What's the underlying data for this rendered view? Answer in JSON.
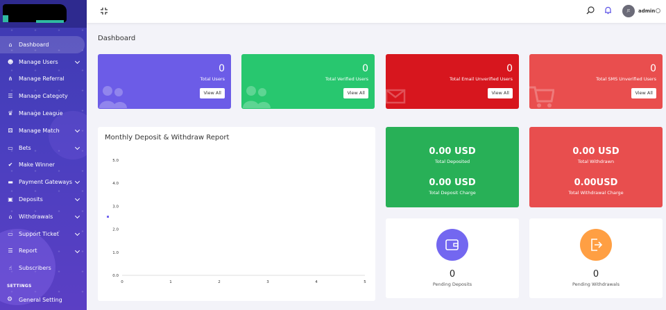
{
  "sidebar": {
    "items": [
      {
        "label": "Dashboard",
        "icon": "home-icon",
        "active": true
      },
      {
        "label": "Manage Users",
        "icon": "users-icon",
        "dropdown": true
      },
      {
        "label": "Manage Referral",
        "icon": "sitemap-icon"
      },
      {
        "label": "Manage Categoty",
        "icon": "list-icon"
      },
      {
        "label": "Manage League",
        "icon": "trophy-icon"
      },
      {
        "label": "Manage Match",
        "icon": "gamepad-icon",
        "dropdown": true
      },
      {
        "label": "Bets",
        "icon": "ticket-icon",
        "dropdown": true
      },
      {
        "label": "Make Winner",
        "icon": "user-check-icon"
      },
      {
        "label": "Payment Gateways",
        "icon": "credit-card-icon",
        "dropdown": true
      },
      {
        "label": "Deposits",
        "icon": "wallet-icon",
        "dropdown": true
      },
      {
        "label": "Withdrawals",
        "icon": "bank-icon",
        "dropdown": true
      },
      {
        "label": "Support Ticket",
        "icon": "ticket-icon",
        "dropdown": true
      },
      {
        "label": "Report",
        "icon": "list-icon",
        "dropdown": true
      },
      {
        "label": "Subscribers",
        "icon": "thumbs-up-icon"
      }
    ],
    "settings_heading": "SETTINGS",
    "general_setting": "General Setting"
  },
  "topbar": {
    "user_name": "admin",
    "avatar_initials": "JE"
  },
  "page_title": "Dashboard",
  "stats": [
    {
      "value": "0",
      "label": "Total Users",
      "button": "View All",
      "color": "#6c5ce7",
      "icon": "users-icon"
    },
    {
      "value": "0",
      "label": "Total Verified Users",
      "button": "View All",
      "color": "#28c76f",
      "icon": "users-icon"
    },
    {
      "value": "0",
      "label": "Total Email Unverified Users",
      "button": "View All",
      "color": "#d7161e",
      "icon": "envelope-icon"
    },
    {
      "value": "0",
      "label": "Total SMS Unverified Users",
      "button": "View All",
      "color": "#e94e4e",
      "icon": "cart-icon"
    }
  ],
  "amounts": [
    {
      "value": "0.00 USD",
      "label": "Total Deposited",
      "value2": "0.00 USD",
      "label2": "Total Deposit Charge",
      "color": "#28b057"
    },
    {
      "value": "0.00 USD",
      "label": "Total Withdrawn",
      "value2": "0.00USD",
      "label2": "Total Withdrawal Charge",
      "color": "#e84e4e"
    }
  ],
  "pending": [
    {
      "value": "0",
      "label": "Pending Deposits",
      "color": "#7367f0",
      "icon": "wallet-icon"
    },
    {
      "value": "0",
      "label": "Pending Withdrawals",
      "color": "#ff9f43",
      "icon": "sign-out-icon"
    }
  ],
  "chart_data": {
    "type": "line",
    "title": "Monthly Deposit & Withdraw Report",
    "x": [
      0,
      1,
      2,
      3,
      4,
      5
    ],
    "xlim": [
      0,
      5
    ],
    "ylim": [
      0,
      5
    ],
    "yticks": [
      "0.0",
      "1.0",
      "2.0",
      "3.0",
      "4.0",
      "5.0"
    ],
    "xticks": [
      "0",
      "1",
      "2",
      "3",
      "4",
      "5"
    ],
    "series": []
  }
}
